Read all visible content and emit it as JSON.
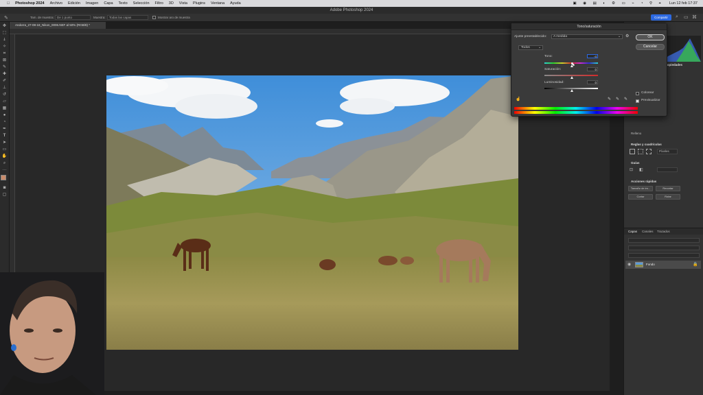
{
  "menubar": {
    "app": "Photoshop 2024",
    "items": [
      "Archivo",
      "Edición",
      "Imagen",
      "Capa",
      "Texto",
      "Selección",
      "Filtro",
      "3D",
      "Vista",
      "Plugins",
      "Ventana",
      "Ayuda"
    ],
    "clock": "Lun 12 feb 17:37"
  },
  "titlebar": {
    "title": "Adobe Photoshop 2024"
  },
  "options": {
    "sample_label": "Tam. de muestra:",
    "sample_value": "De 1 punto",
    "layers_label": "Muestra:",
    "layers_value": "Todas las capas",
    "ring_label": "Mostrar aro de muestra",
    "share": "Compartir"
  },
  "document": {
    "tab": "Andorra_27-08-18_Nikon_0006.NEF al 50% (RGB/8) *"
  },
  "dialog": {
    "title": "Tono/saturación",
    "preset_label": "Ajuste preestablecido:",
    "preset_value": "A medida",
    "channel": "Todos",
    "hue_label": "Tono:",
    "hue_value": "-4",
    "saturation_label": "Saturación:",
    "saturation_value": "0",
    "lightness_label": "Luminosidad:",
    "lightness_value": "0",
    "ok": "OK",
    "cancel": "Cancelar",
    "colorize": "Colorear",
    "preview": "Previsualizar",
    "preview_checked": true,
    "colorize_checked": false
  },
  "right_panel": {
    "tab_props": "Propiedades",
    "fill_label": "Relleno",
    "rules_title": "Reglas y cuadrículas",
    "units_value": "Píxeles",
    "guides_title": "Guías",
    "quick_title": "Acciones rápidas",
    "btn_image_size": "Tamaño de im...",
    "btn_crop": "Recortar",
    "btn_trim": "Cortar",
    "btn_rotate": "Rotar",
    "layers_tabs": [
      "Capas",
      "Canales",
      "Trazados"
    ],
    "layer_name": "Fondo"
  },
  "colors": {
    "accent": "#2d6ae3",
    "panel": "#323232",
    "dialog": "#3a3a3a"
  }
}
